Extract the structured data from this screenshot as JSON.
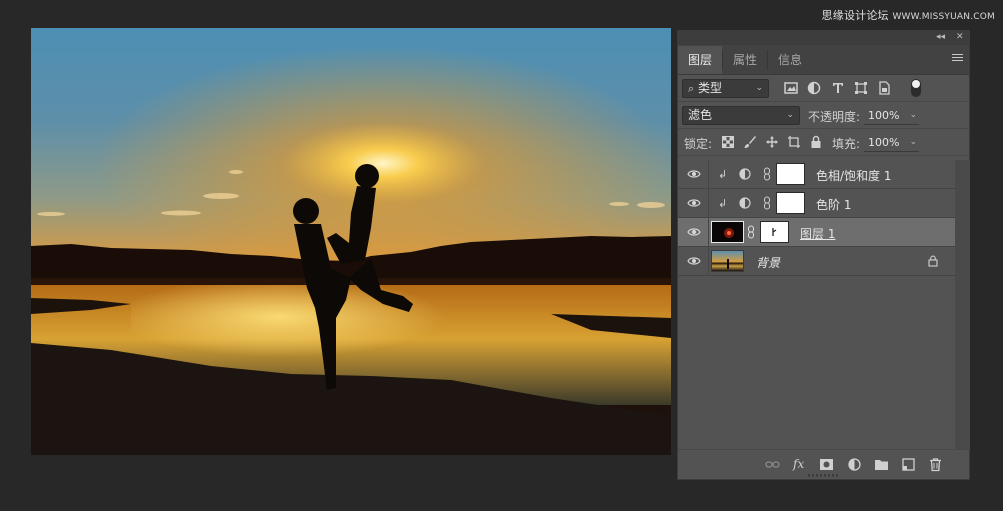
{
  "watermark": {
    "cn": "思缘设计论坛",
    "site": "WWW.MISSYUAN.COM"
  },
  "panel": {
    "tabs": [
      {
        "label": "图层",
        "active": true
      },
      {
        "label": "属性",
        "active": false
      },
      {
        "label": "信息",
        "active": false
      }
    ],
    "filter": {
      "kind_label": "类型",
      "icons": [
        "image-filter-icon",
        "adjustment-filter-icon",
        "type-filter-icon",
        "shape-filter-icon",
        "smart-object-filter-icon"
      ]
    },
    "blend_mode": "滤色",
    "opacity": {
      "label": "不透明度:",
      "value": "100%"
    },
    "lock": {
      "label": "锁定:"
    },
    "fill": {
      "label": "填充:",
      "value": "100%"
    },
    "layers": [
      {
        "name": "色相/饱和度 1",
        "type": "adjustment",
        "selected": false
      },
      {
        "name": "色阶 1",
        "type": "adjustment",
        "selected": false
      },
      {
        "name": "图层 1",
        "type": "pixel",
        "selected": true
      },
      {
        "name": "背景",
        "type": "background",
        "selected": false,
        "locked": true
      }
    ],
    "footer_icons": [
      "link-layers-icon",
      "fx-icon",
      "add-mask-icon",
      "new-adjustment-icon",
      "new-group-icon",
      "new-layer-icon",
      "delete-layer-icon"
    ],
    "fx_label": "fx"
  }
}
